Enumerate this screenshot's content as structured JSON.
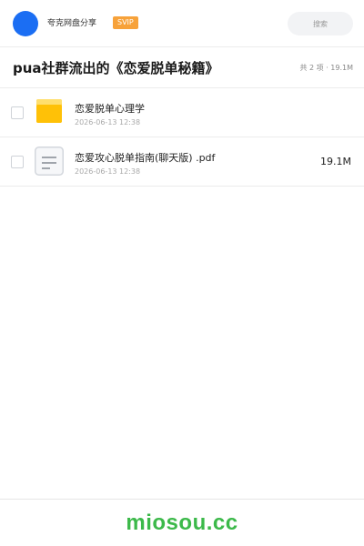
{
  "header": {
    "app_name": "夸克网盘分享",
    "badge": "SVIP",
    "search_placeholder": "搜索",
    "avatar_color": "#1b6ef3",
    "badge_color": "#f7a23a"
  },
  "title_bar": {
    "title": "pua社群流出的《恋爱脱单秘籍》",
    "summary": "共 2 项 · 19.1M"
  },
  "files": [
    {
      "name": "恋爱脱单心理学",
      "date": "2026-06-13 12:38",
      "size": "",
      "icon": "folder-icon"
    },
    {
      "name": "恋爱攻心脱单指南(聊天版) .pdf",
      "date": "2026-06-13 12:38",
      "size": "19.1M",
      "icon": "document-icon"
    }
  ],
  "footer": {
    "watermark": "miosou.cc",
    "watermark_color": "#3cb94a"
  }
}
